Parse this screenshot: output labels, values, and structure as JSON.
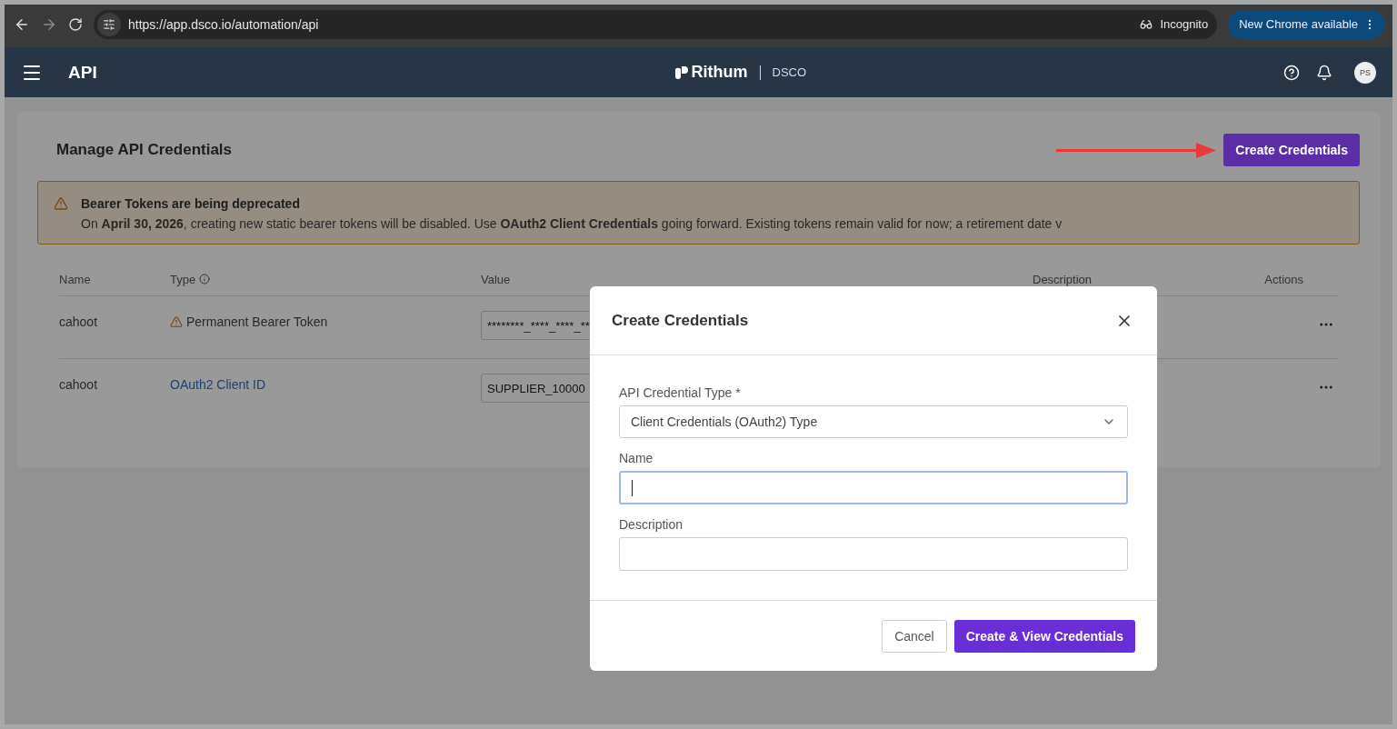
{
  "browser": {
    "url": "https://app.dsco.io/automation/api",
    "incognito_label": "Incognito",
    "update_button": "New Chrome available"
  },
  "header": {
    "title": "API",
    "brand": "Rithum",
    "product": "DSCO",
    "avatar": "PS"
  },
  "card": {
    "title": "Manage API Credentials",
    "create_button": "Create Credentials"
  },
  "alert": {
    "title": "Bearer Tokens are being deprecated",
    "text": "On **April 30, 2026**, creating new static bearer tokens will be disabled. Use **OAuth2 Client Credentials** going forward. Existing tokens remain valid for now; a retirement date v"
  },
  "table": {
    "columns": [
      "Name",
      "Type",
      "Value",
      "Description",
      "Actions"
    ],
    "rows": [
      {
        "name": "cahoot",
        "type": "Permanent Bearer Token",
        "kind": "warning",
        "value": "********_****_****_**"
      },
      {
        "name": "cahoot",
        "type": "OAuth2 Client ID",
        "kind": "link",
        "value": "SUPPLIER_10000"
      }
    ]
  },
  "dialog": {
    "title": "Create Credentials",
    "fields": [
      {
        "kind": "select",
        "label": "API Credential Type *",
        "value": "Client Credentials (OAuth2) Type",
        "focused": false
      },
      {
        "kind": "text",
        "label": "Name",
        "focused": true
      },
      {
        "kind": "text",
        "label": "Description",
        "focused": false
      }
    ],
    "buttons": [
      {
        "label": "Cancel",
        "primary": false
      },
      {
        "label": "Create & View Credentials",
        "primary": true
      }
    ]
  }
}
